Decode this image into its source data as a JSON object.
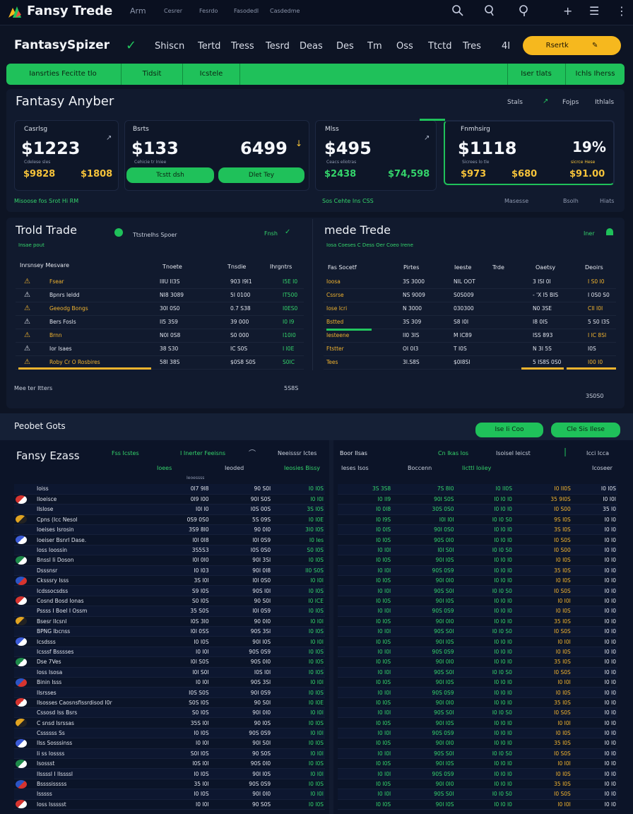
{
  "topbar": {
    "app_name": "Fansy Trede",
    "nav": [
      "Arm",
      "Cesrer",
      "Fesrdo",
      "Fasodedl",
      "Casdedme"
    ],
    "icons": [
      "search-icon",
      "search-icon",
      "search-icon",
      "plus-icon",
      "menu-icon",
      "kebab-icon"
    ]
  },
  "subheader": {
    "brand": "FantasySpizer",
    "nav": [
      "Shiscn",
      "Tertd",
      "Tress",
      "Tesrd",
      "Deas",
      "Des",
      "Tm",
      "Oss",
      "Ttctd",
      "Tres",
      "4I"
    ],
    "cta_label": "Rsertk",
    "cta_icon": "pencil-icon"
  },
  "greenbar": {
    "left": [
      "Iansrties Fecitte tlo",
      "Tidsit",
      "Icstele"
    ],
    "right": [
      "Iser tlats",
      "Ichls Iherss"
    ]
  },
  "summary": {
    "title": "Fantasy Anyber",
    "links": [
      "Stals",
      "Fojps",
      "Ithlals"
    ],
    "foot_left": "Misoose fos Srot Hi RM",
    "foot_mid": "Sos Cehte Ins CSS",
    "foot_right": [
      "Masesse",
      "Bsolh",
      "Hiats"
    ],
    "cards": [
      {
        "label": "Casrlsg",
        "big": "$1223",
        "sub": "Cdelese sles",
        "v1": "$9828",
        "v2": "$1808"
      },
      {
        "label": "Bsrts",
        "big": "$133",
        "big2": "6499",
        "sub": "Cehicie tr Iniee",
        "btn1": "Tcstt dsh",
        "btn2": "Dlet Tey"
      },
      {
        "label": "Mlss",
        "big": "$495",
        "sub": "Ceacs eliotras",
        "v1": "$2438",
        "v2": "$74,598"
      },
      {
        "label": "Fnmhsirg",
        "big": "$1118",
        "big2": "19%",
        "sub": "Sicrees lo tle",
        "note": "sicrce Hese",
        "v1": "$973",
        "v2": "$680",
        "v3": "$91.00"
      }
    ]
  },
  "trade_left": {
    "title": "Trold Trade",
    "subtitle": "Insae pout",
    "badge": "Ttstnelhs Spoer",
    "link": "Fnsh",
    "headers": [
      "Inrsnsey Mesvare",
      "Tnoete",
      "Tnsdie",
      "Ihrgntrs"
    ],
    "rows": [
      {
        "name": "Fsear",
        "a": "IIIU II3S",
        "b": "903 I9I1",
        "c": "I5E I0"
      },
      {
        "name": "Bpnrs Ieldd",
        "a": "NI8 3089",
        "b": "5I 0100",
        "c": "IT500"
      },
      {
        "name": "Geeodg Bongs",
        "a": "30I 0S0",
        "b": "0.7 S38",
        "c": "I0ES0"
      },
      {
        "name": "Bers Fosls",
        "a": "II5 3S9",
        "b": "39 000",
        "c": "I0 I9"
      },
      {
        "name": "Brnn",
        "a": "N0I 0S8",
        "b": "S0 000",
        "c": "I10I0"
      },
      {
        "name": "Ior Isaes",
        "a": "38 S30",
        "b": "IC S0S",
        "c": "I I0E"
      },
      {
        "name": "Roby Cr O Rosbires",
        "a": "58I 38S",
        "b": "$0S8 S0S",
        "c": "S0IC"
      }
    ],
    "footer_left": "Mee ter Itters",
    "footer_right": "5S8S"
  },
  "trade_right": {
    "title": "mede Trede",
    "subtitle": "Iosa Coeses C Dess Oer Coeo Irene",
    "link": "Iner",
    "headers": [
      "Fas Socetf",
      "Pirtes",
      "Ieeste",
      "Trde",
      "Oaetsy",
      "Deoirs"
    ],
    "rows": [
      {
        "n": "Ioosa",
        "a": "3S 3000",
        "b": "NIL OOT",
        "c": "3 ISI 0I",
        "d": "I S0 I0"
      },
      {
        "n": "Cssrse",
        "a": "NS 9009",
        "b": "S0S009",
        "c": "- 'X I5 BIS",
        "d": "I 0S0 S0"
      },
      {
        "n": "Iose Icri",
        "a": "N 3000",
        "b": "030300",
        "c": "N0 3SE",
        "d": "CII I0I"
      },
      {
        "n": "Bstted",
        "a": "3S 309",
        "b": "S8 I0I",
        "c": "I8 0IS",
        "d": "5 S0 I3S"
      },
      {
        "n": "Iesteene",
        "a": "II0 3IS",
        "b": "M IC89",
        "c": "ISS 893",
        "d": "I IC 8SI"
      },
      {
        "n": "Ftstter",
        "a": "OI 0I3",
        "b": "T I0S",
        "c": "N 3I 5S",
        "d": "I0S"
      },
      {
        "n": "Tees",
        "a": "3I.S8S",
        "b": "$0I8SI",
        "c": "5 IS8S 0S0",
        "d": "I00 I0"
      }
    ],
    "footer_right": "3S0S0"
  },
  "product": {
    "title": "Peobet Gots",
    "btn1": "Ise Ii Coo",
    "btn2": "Cle Sis Ilese"
  },
  "sheet_left": {
    "title": "Fansy Ezass",
    "tags": [
      "Fss Icstes",
      "I Inerter Feeisns",
      "Neeisssr Ictes"
    ],
    "headers": [
      "Ioees",
      "Ieoessss",
      "Ieoded",
      "Ieosies Bissy"
    ],
    "rows": [
      [
        "Ioiss",
        "0I7 9I8",
        "90 S0I",
        "I0 I0S"
      ],
      [
        "Iloeisce",
        "0I9 I00",
        "90I S0S",
        "I0 I0I"
      ],
      [
        "Ilslose",
        "I0I I0",
        "I0S 00S",
        "3S I0S"
      ],
      [
        "Cpns (Icc Nesol",
        "0S9 0S0",
        "5S 09S",
        "I0 I0E"
      ],
      [
        "Ioeises Isrosin",
        "3S9 8I0",
        "90 0I0",
        "3I0 I0S"
      ],
      [
        "Ioeiser Bsnrl Dase.",
        "I0I 0I8",
        "I0I 0S9",
        "I0 Ies"
      ],
      [
        "Ioss Ioossin",
        "3S5S3",
        "I0S 0S0",
        "S0 I0S"
      ],
      [
        "Bnssl Ii Doson",
        "I0I 0I0",
        "90I 3SI",
        "I0 I0S"
      ],
      [
        "Dsssnsr",
        "I0 I03",
        "90I 0I8",
        "II0 S0S"
      ],
      [
        "Cksssry Isss",
        "3S I0I",
        "I0I 0S0",
        "I0 I0I"
      ],
      [
        "Icdssocsdss",
        "S9 I0S",
        "90S I0I",
        "I0 I0S"
      ],
      [
        "Cosnd Bosd Ionas",
        "S0 I0S",
        "90 S0I",
        "I0 ICE"
      ],
      [
        "Pssss I Boel I Ossm",
        "35 S0S",
        "I0I 0S9",
        "I0 I0S"
      ],
      [
        "Bsesr IIcsnl",
        "I0S 3I0",
        "90 0I0",
        "I0 I0I"
      ],
      [
        "BPNG Ibcnss",
        "I0I 0SS",
        "90S 3SI",
        "I0 I0S"
      ],
      [
        "Icsdsss",
        "I0 I0S",
        "90I I0S",
        "I0 I0I"
      ],
      [
        "Icsssf Bsssses",
        "I0 I0I",
        "90S 0S9",
        "I0 I0S"
      ],
      [
        "Dse 7Ves",
        "I0I S0S",
        "90S 0I0",
        "I0 I0S"
      ],
      [
        "Ioss Isosa",
        "I0I S0I",
        "I0S I0I",
        "I0 I0S"
      ],
      [
        "Binin Isss",
        "I0 I0I",
        "90S 3SI",
        "I0 I0I"
      ],
      [
        "Ilsrsses",
        "I0S S0S",
        "90I 0S9",
        "I0 I0S"
      ],
      [
        "Ilsosses Caosnsfissrdisod I0r",
        "S0S I0S",
        "90 S0I",
        "I0 I0E"
      ],
      [
        "Cssosd Iss Bsrs",
        "S0 I0S",
        "90I 0I0",
        "I0 I0I"
      ],
      [
        "C snsd Isrssas",
        "35S I0I",
        "90 I0S",
        "I0 I0S"
      ],
      [
        "Cssssss Ss",
        "I0 I0S",
        "90S 0S9",
        "I0 I0I"
      ],
      [
        "Ilss Sosssinss",
        "I0 I0I",
        "90I S0I",
        "I0 I0S"
      ],
      [
        "Ii ss Iossss",
        "S0I I0S",
        "90 S0S",
        "I0 I0I"
      ],
      [
        "Isossst",
        "I0S I0I",
        "90S 0I0",
        "I0 I0S"
      ],
      [
        "Ilssssl I Ilssssl",
        "I0 I0S",
        "90I I0S",
        "I0 I0I"
      ],
      [
        "Bssssisssss",
        "35 I0I",
        "90S 0S9",
        "I0 I0S"
      ],
      [
        "Isssss",
        "I0 I0S",
        "90I 0I0",
        "I0 I0I"
      ],
      [
        "Ioss Issssst",
        "I0 I0I",
        "90 S0S",
        "I0 I0S"
      ]
    ]
  },
  "sheet_right": {
    "title": "Boor Ilsas",
    "tags": [
      "Cn Ikas Ios",
      "Isoisel Ieicst",
      "Icci Icca"
    ],
    "headers": [
      "Ieses Isos",
      "Boccenn",
      "Iicttl Ioiiey",
      "Icoseer"
    ],
    "rows": [
      [
        "3S 3S8",
        "7S 8I0",
        "I0 II0S",
        "I0 II0S",
        "I0 I0S"
      ],
      [
        "I0 II9",
        "90I S0S",
        "I0 I0 I0",
        "35 9I0S",
        "I0 I0I"
      ],
      [
        "I0 0I8",
        "30S 0S0",
        "I0 I0 I0",
        "I0 S00",
        "35 I0"
      ],
      [
        "I0 I9S",
        "I0I I0I",
        "I0 I0 S0",
        "9S I0S",
        "I0 I0"
      ],
      [
        "I0 0IS",
        "90I 0S0",
        "I0 I0 I0",
        "3S I0S",
        "I0 I0"
      ],
      [
        "I0 I0S",
        "90S 0I0",
        "I0 I0 I0",
        "I0 S0S",
        "I0 I0"
      ],
      [
        "I0 I0I",
        "I0I S0I",
        "I0 I0 S0",
        "I0 S00",
        "I0 I0"
      ],
      [
        "I0 I0S",
        "90I I0S",
        "I0 I0 I0",
        "I0 I0S",
        "I0 I0"
      ],
      [
        "I0 I0I",
        "90S 0S9",
        "I0 I0 I0",
        "35 I0S",
        "I0 I0"
      ],
      [
        "I0 I0S",
        "90I 0I0",
        "I0 I0 I0",
        "I0 I0S",
        "I0 I0"
      ],
      [
        "I0 I0I",
        "90S S0I",
        "I0 I0 S0",
        "I0 S0S",
        "I0 I0"
      ],
      [
        "I0 I0S",
        "90I I0S",
        "I0 I0 I0",
        "I0 I0I",
        "I0 I0"
      ],
      [
        "I0 I0I",
        "90S 0S9",
        "I0 I0 I0",
        "I0 I0S",
        "I0 I0"
      ],
      [
        "I0 I0S",
        "90I 0I0",
        "I0 I0 I0",
        "35 I0S",
        "I0 I0"
      ],
      [
        "I0 I0I",
        "90S S0I",
        "I0 I0 S0",
        "I0 S0S",
        "I0 I0"
      ],
      [
        "I0 I0S",
        "90I I0S",
        "I0 I0 I0",
        "I0 I0I",
        "I0 I0"
      ],
      [
        "I0 I0I",
        "90S 0S9",
        "I0 I0 I0",
        "I0 I0S",
        "I0 I0"
      ],
      [
        "I0 I0S",
        "90I 0I0",
        "I0 I0 I0",
        "35 I0S",
        "I0 I0"
      ],
      [
        "I0 I0I",
        "90S S0I",
        "I0 I0 S0",
        "I0 S0S",
        "I0 I0"
      ],
      [
        "I0 I0S",
        "90I I0S",
        "I0 I0 I0",
        "I0 I0I",
        "I0 I0"
      ],
      [
        "I0 I0I",
        "90S 0S9",
        "I0 I0 I0",
        "I0 I0S",
        "I0 I0"
      ],
      [
        "I0 I0S",
        "90I 0I0",
        "I0 I0 I0",
        "35 I0S",
        "I0 I0"
      ],
      [
        "I0 I0I",
        "90S S0I",
        "I0 I0 S0",
        "I0 S0S",
        "I0 I0"
      ],
      [
        "I0 I0S",
        "90I I0S",
        "I0 I0 I0",
        "I0 I0I",
        "I0 I0"
      ],
      [
        "I0 I0I",
        "90S 0S9",
        "I0 I0 I0",
        "I0 I0S",
        "I0 I0"
      ],
      [
        "I0 I0S",
        "90I 0I0",
        "I0 I0 I0",
        "35 I0S",
        "I0 I0"
      ],
      [
        "I0 I0I",
        "90S S0I",
        "I0 I0 S0",
        "I0 S0S",
        "I0 I0"
      ],
      [
        "I0 I0S",
        "90I I0S",
        "I0 I0 I0",
        "I0 I0I",
        "I0 I0"
      ],
      [
        "I0 I0I",
        "90S 0S9",
        "I0 I0 I0",
        "I0 I0S",
        "I0 I0"
      ],
      [
        "I0 I0S",
        "90I 0I0",
        "I0 I0 I0",
        "35 I0S",
        "I0 I0"
      ],
      [
        "I0 I0I",
        "90S S0I",
        "I0 I0 S0",
        "I0 S0S",
        "I0 I0"
      ],
      [
        "I0 I0S",
        "90I I0S",
        "I0 I0 I0",
        "I0 I0I",
        "I0 I0"
      ]
    ]
  },
  "colors": {
    "accent_green": "#1fc15a",
    "accent_yellow": "#f6b81e",
    "bg": "#0d1424"
  }
}
